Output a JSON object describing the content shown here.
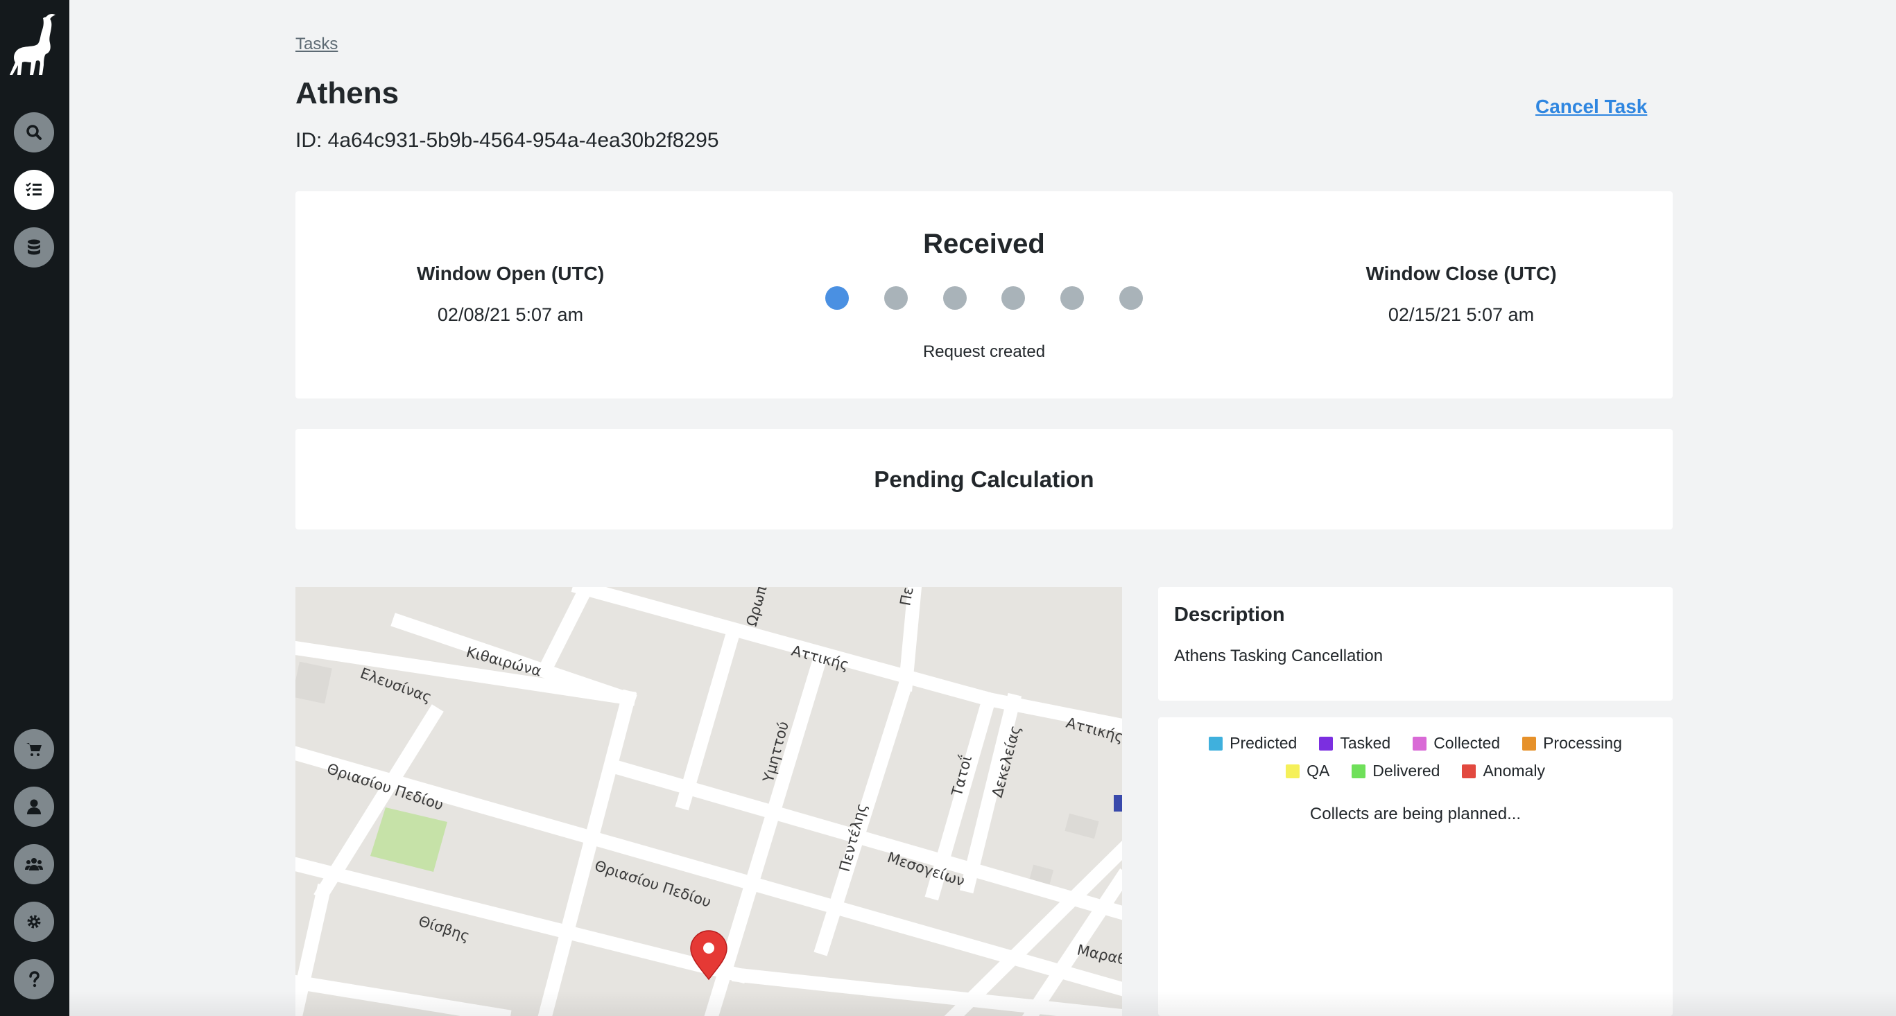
{
  "sidebar": {
    "logo": "ibex-logo",
    "top_items": [
      {
        "icon": "search-icon"
      },
      {
        "icon": "task-list-icon",
        "active": true
      },
      {
        "icon": "database-icon"
      }
    ],
    "bottom_items": [
      {
        "icon": "cart-icon"
      },
      {
        "icon": "user-icon"
      },
      {
        "icon": "team-icon"
      },
      {
        "icon": "settings-icon"
      },
      {
        "icon": "help-icon"
      }
    ]
  },
  "header": {
    "breadcrumb": "Tasks",
    "title": "Athens",
    "task_id": "ID: 4a64c931-5b9b-4564-954a-4ea30b2f8295",
    "cancel_label": "Cancel Task"
  },
  "status": {
    "window_open_label": "Window Open (UTC)",
    "window_open_value": "02/08/21 5:07 am",
    "window_close_label": "Window Close (UTC)",
    "window_close_value": "02/15/21 5:07 am",
    "state": "Received",
    "state_description": "Request created",
    "steps_total": 6,
    "steps_active": 1,
    "step_active_color": "#4a90e2",
    "step_inactive_color": "#a9b3b9"
  },
  "pending": {
    "label": "Pending Calculation"
  },
  "map": {
    "street_labels": {
      "kithairona": "Κιθαιρώνα",
      "elefsinas": "Ελευσίνας",
      "oropou": "Ωρωπού",
      "attikis_1": "Αττικής",
      "attikis_2": "Αττικής",
      "pe": "Πε",
      "ymittou": "Υμηττού",
      "tatoi": "Τατοΐ",
      "dekeleias": "Δεκελείας",
      "thriasiou_1": "Θριασίου Πεδίου",
      "thriasiou_2": "Θριασίου Πεδίου",
      "thisvis": "Θίσβης",
      "pentelis": "Πεντέλης",
      "mesogeion": "Μεσογείων",
      "marath": "Μαραθ"
    },
    "marker_icon": "location-pin-icon",
    "marker_color": "#e53935"
  },
  "description": {
    "title": "Description",
    "text": "Athens Tasking Cancellation"
  },
  "legend": {
    "row1": [
      {
        "label": "Predicted",
        "color": "#3fb0dd"
      },
      {
        "label": "Tasked",
        "color": "#7b2fe0"
      },
      {
        "label": "Collected",
        "color": "#d96ad6"
      },
      {
        "label": "Processing",
        "color": "#e6912a"
      }
    ],
    "row2": [
      {
        "label": "QA",
        "color": "#f5f05a"
      },
      {
        "label": "Delivered",
        "color": "#6fe05a"
      },
      {
        "label": "Anomaly",
        "color": "#e2493f"
      }
    ],
    "status_text": "Collects are being planned..."
  }
}
